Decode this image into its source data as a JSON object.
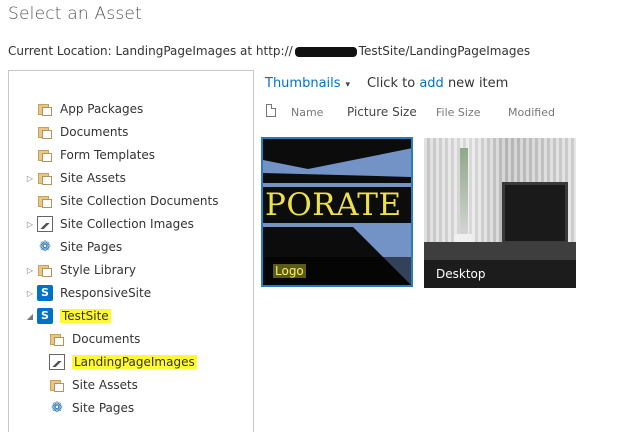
{
  "dialog": {
    "title": "Select an Asset",
    "location_prefix": "Current Location: LandingPageImages at http://",
    "location_suffix": "TestSite/LandingPageImages"
  },
  "tree": {
    "items": [
      {
        "label": "App Packages",
        "icon": "library-icon",
        "expander": ""
      },
      {
        "label": "Documents",
        "icon": "library-icon",
        "expander": ""
      },
      {
        "label": "Form Templates",
        "icon": "library-icon",
        "expander": ""
      },
      {
        "label": "Site Assets",
        "icon": "library-icon",
        "expander": "▷"
      },
      {
        "label": "Site Collection Documents",
        "icon": "library-icon",
        "expander": ""
      },
      {
        "label": "Site Collection Images",
        "icon": "picture-library-icon",
        "expander": "▷"
      },
      {
        "label": "Site Pages",
        "icon": "site-pages-icon",
        "expander": ""
      },
      {
        "label": "Style Library",
        "icon": "library-icon",
        "expander": "▷"
      },
      {
        "label": "ResponsiveSite",
        "icon": "sharepoint-site-icon",
        "expander": "▷"
      },
      {
        "label": "TestSite",
        "icon": "sharepoint-site-icon",
        "expander": "◢"
      },
      {
        "label": "Documents",
        "icon": "library-icon",
        "expander": ""
      },
      {
        "label": "LandingPageImages",
        "icon": "picture-library-icon",
        "expander": ""
      },
      {
        "label": "Site Assets",
        "icon": "library-icon",
        "expander": ""
      },
      {
        "label": "Site Pages",
        "icon": "site-pages-icon",
        "expander": ""
      }
    ],
    "sp_glyph": "S",
    "gear_glyph": "❁"
  },
  "content": {
    "view_label": "Thumbnails",
    "view_caret": "▾",
    "add_prefix": "Click to",
    "add_link": "add",
    "add_suffix": "new item",
    "columns": [
      "Name",
      "Picture Size",
      "File Size",
      "Modified"
    ],
    "thumbnails": [
      {
        "caption": "Logo",
        "selected": true,
        "logo_text": "PORATE"
      },
      {
        "caption": "Desktop",
        "selected": false
      }
    ]
  },
  "colors": {
    "accent": "#0072c6",
    "highlight": "#fff833"
  }
}
